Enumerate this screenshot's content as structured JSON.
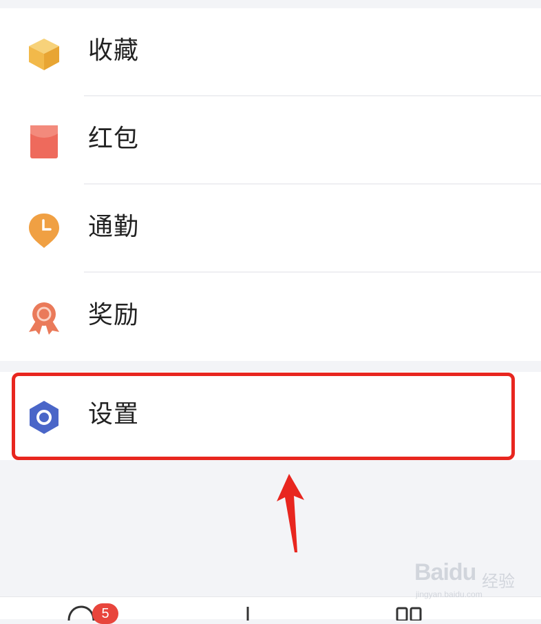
{
  "menu": {
    "items": [
      {
        "label": "收藏",
        "icon": "favorites-box-icon",
        "color": "#f2b94a"
      },
      {
        "label": "红包",
        "icon": "red-envelope-icon",
        "color": "#ee6a5c"
      },
      {
        "label": "通勤",
        "icon": "commute-clock-pin-icon",
        "color": "#f0a043"
      },
      {
        "label": "奖励",
        "icon": "reward-medal-icon",
        "color": "#ea7a5a"
      }
    ]
  },
  "settings": {
    "label": "设置",
    "icon": "settings-hexagon-icon",
    "color": "#4a66c8"
  },
  "annotation": {
    "highlight_color": "#e8261f"
  },
  "tabbar": {
    "badge_count": "5"
  },
  "watermark": {
    "brand": "Baidu",
    "brand_cn": "经验",
    "url": "jingyan.baidu.com"
  }
}
